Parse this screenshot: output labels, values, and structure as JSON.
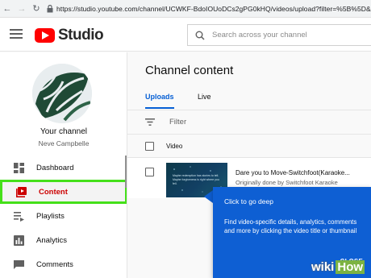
{
  "browser": {
    "url": "https://studio.youtube.com/channel/UCWKF-BdoIOUoDCs2gPG0kHQ/videos/upload?filter=%5B%5D&s"
  },
  "header": {
    "logo_text": "Studio",
    "search_placeholder": "Search across your channel"
  },
  "sidebar": {
    "channel_label": "Your channel",
    "channel_name": "Neve Campbelle",
    "items": [
      {
        "label": "Dashboard",
        "icon": "dashboard-icon"
      },
      {
        "label": "Content",
        "icon": "content-icon",
        "active": true
      },
      {
        "label": "Playlists",
        "icon": "playlists-icon"
      },
      {
        "label": "Analytics",
        "icon": "analytics-icon"
      },
      {
        "label": "Comments",
        "icon": "comments-icon"
      }
    ]
  },
  "main": {
    "title": "Channel content",
    "tabs": [
      {
        "label": "Uploads",
        "active": true
      },
      {
        "label": "Live"
      }
    ],
    "filter_label": "Filter",
    "column_video": "Video",
    "video": {
      "title": "Dare you to Move-Switchfoot(Karaoke...",
      "subtitle": "Originally done by Switchfoot Karaoke",
      "thumbnail_caption": "Maybe redemption has stories to tell. Maybe forgiveness is right where you fell."
    }
  },
  "tooltip": {
    "title": "Click to go deep",
    "body": "Find video-specific details, analytics, comments and more by clicking the video title or thumbnail",
    "close_label": "CLOSE"
  },
  "watermark": {
    "wiki": "wiki",
    "how": "How"
  },
  "colors": {
    "accent_blue": "#065fd4",
    "tooltip_blue": "#0e5fd3",
    "active_red": "#cc0000",
    "highlight_green": "#45e01a"
  }
}
